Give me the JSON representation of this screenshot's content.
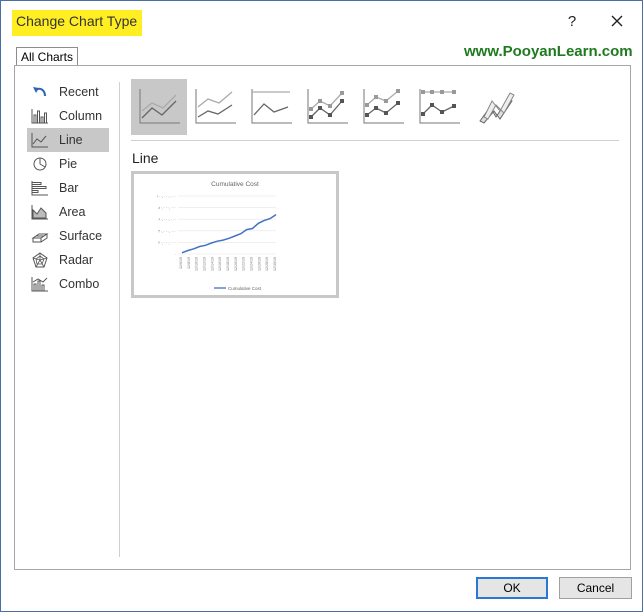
{
  "window": {
    "title": "Change Chart Type",
    "help_label": "?"
  },
  "tabs": [
    {
      "label": "All Charts",
      "selected": true
    }
  ],
  "watermark": "www.PooyanLearn.com",
  "sidebar": {
    "items": [
      {
        "label": "Recent",
        "icon": "recent-icon",
        "selected": false
      },
      {
        "label": "Column",
        "icon": "column-chart-icon",
        "selected": false
      },
      {
        "label": "Line",
        "icon": "line-chart-icon",
        "selected": true
      },
      {
        "label": "Pie",
        "icon": "pie-chart-icon",
        "selected": false
      },
      {
        "label": "Bar",
        "icon": "bar-chart-icon",
        "selected": false
      },
      {
        "label": "Area",
        "icon": "area-chart-icon",
        "selected": false
      },
      {
        "label": "Surface",
        "icon": "surface-chart-icon",
        "selected": false
      },
      {
        "label": "Radar",
        "icon": "radar-chart-icon",
        "selected": false
      },
      {
        "label": "Combo",
        "icon": "combo-chart-icon",
        "selected": false
      }
    ]
  },
  "subtypes": [
    {
      "icon": "line-icon",
      "selected": true
    },
    {
      "icon": "stacked-line-icon",
      "selected": false
    },
    {
      "icon": "100-stacked-line-icon",
      "selected": false
    },
    {
      "icon": "line-with-markers-icon",
      "selected": false
    },
    {
      "icon": "stacked-line-with-markers-icon",
      "selected": false
    },
    {
      "icon": "100-stacked-line-with-markers-icon",
      "selected": false
    },
    {
      "icon": "3d-line-icon",
      "selected": false
    }
  ],
  "section_title": "Line",
  "preview": {
    "chart_data": {
      "type": "line",
      "title": "Cumulative Cost",
      "series": [
        {
          "name": "Cumulative Cost",
          "values": [
            2,
            6,
            9,
            13,
            15,
            19,
            22,
            24,
            27,
            31,
            35,
            42,
            44,
            53,
            58,
            61,
            68
          ]
        }
      ],
      "y_tick_labels": [
        "۱۰۰,۰۰۰,۰۰۰",
        "۸۰,۰۰۰,۰۰۰",
        "۶۰,۰۰۰,۰۰۰",
        "۴۰,۰۰۰,۰۰۰",
        "۲۰,۰۰۰,۰۰۰",
        "۰"
      ],
      "x_tick_labels": [
        "12/6/19",
        "12/8/19",
        "12/10/19",
        "12/12/19",
        "12/14/19",
        "12/16/19",
        "12/18/19",
        "12/20/19",
        "12/22/19",
        "12/24/19",
        "12/26/19",
        "12/28/19",
        "12/30/19"
      ],
      "line_color": "#4472c4"
    }
  },
  "buttons": {
    "ok": "OK",
    "cancel": "Cancel"
  },
  "colors": {
    "title_highlight": "#ffef22",
    "watermark": "#1f7a1f",
    "selection": "#c8c8c8",
    "default_button_border": "#2b78d4"
  }
}
